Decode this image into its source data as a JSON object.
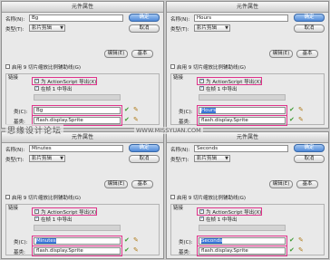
{
  "dialog_title": "元件属性",
  "labels": {
    "name": "名称(N):",
    "type": "类型(T):",
    "ok": "确定",
    "cancel": "取消",
    "edit": "编辑(E)",
    "basic": "基本",
    "scale9": "启用 9 切片缩放比例辅助线(G)",
    "linkage": "链接",
    "export_as": "为 ActionScript 导出(X)",
    "export_frame1": "在帧 1 中导出",
    "class": "类(C):",
    "base_class": "基类:"
  },
  "panels": [
    {
      "name": "Bg",
      "type": "影片剪辑",
      "class": "Bg",
      "base_class": "flash.display.Sprite"
    },
    {
      "name": "Hours",
      "type": "影片剪辑",
      "class": "Hours",
      "base_class": "flash.display.Sprite"
    },
    {
      "name": "Minutes",
      "type": "影片剪辑",
      "class": "Minutes",
      "base_class": "flash.display.Sprite"
    },
    {
      "name": "Seconds",
      "type": "影片剪辑",
      "class": "Seconds",
      "base_class": "flash.display.Sprite"
    }
  ],
  "watermark": {
    "main": "思缘设计论坛",
    "url": "WWW.MISSYUAN.COM"
  },
  "colors": {
    "highlight": "#e0348c",
    "primary_button": "#4f8ad9"
  }
}
